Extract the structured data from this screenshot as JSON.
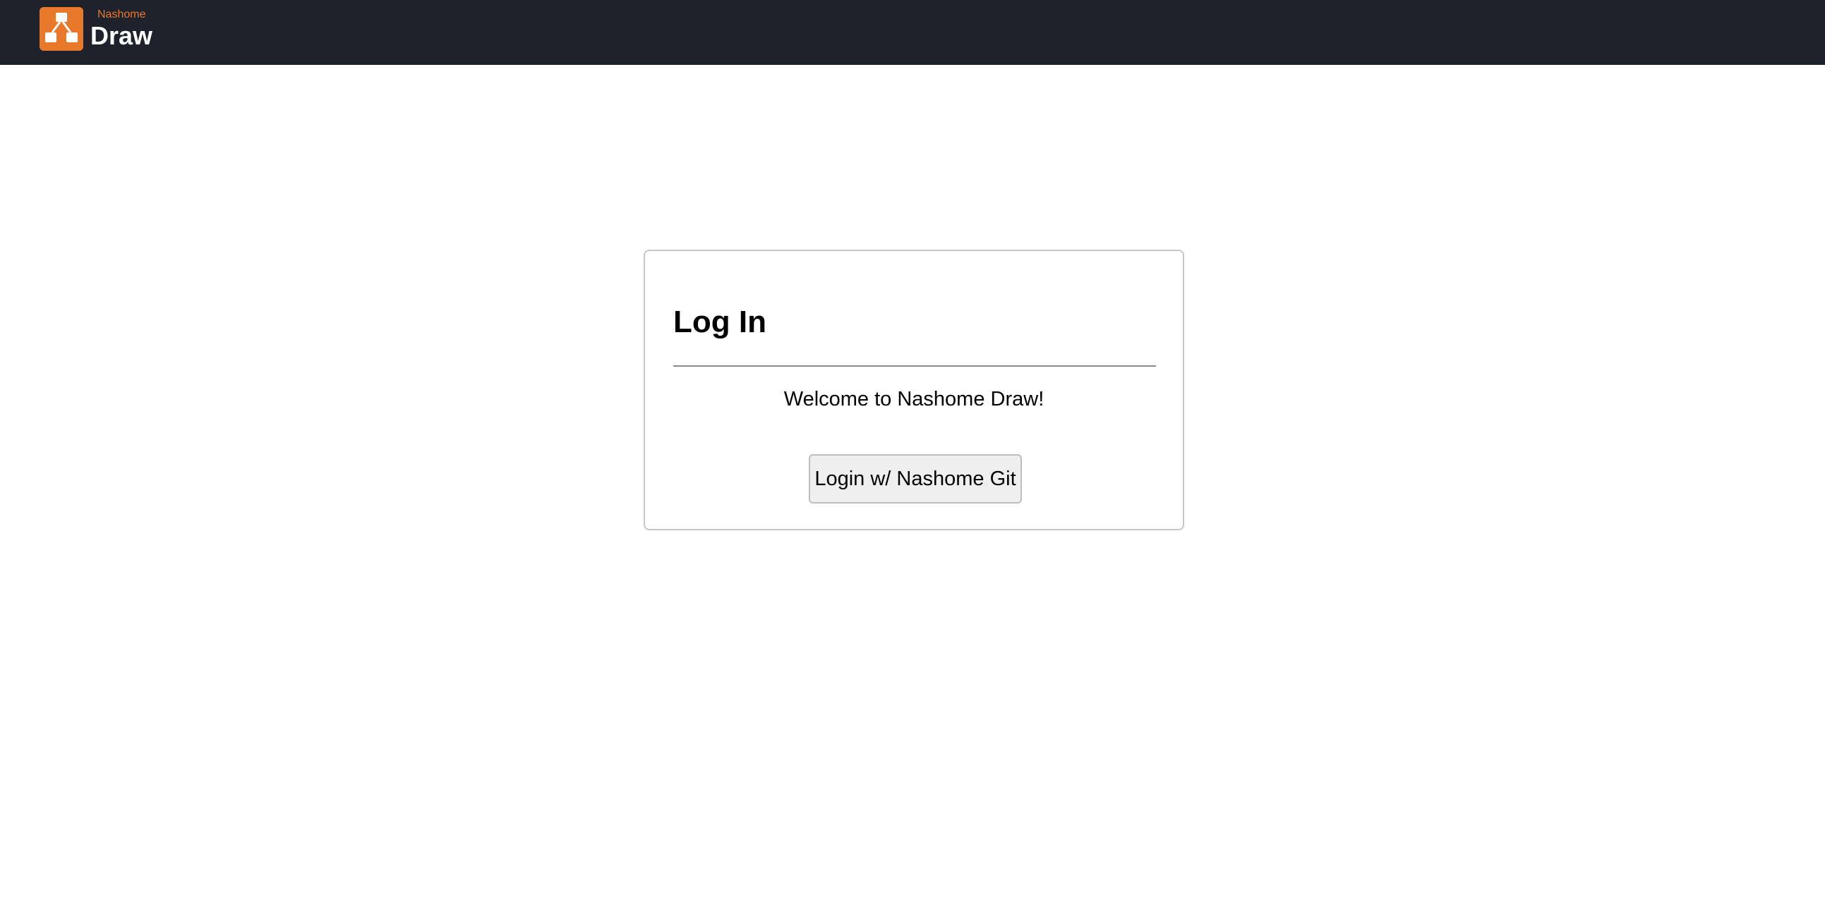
{
  "header": {
    "brand_sub": "Nashome",
    "brand_title": "Draw",
    "logo_icon": "diagram-nodes-icon",
    "colors": {
      "bar_background": "#1f222b",
      "accent": "#e8792a"
    }
  },
  "login_card": {
    "title": "Log In",
    "welcome": "Welcome to Nashome Draw!",
    "button_label": "Login w/ Nashome Git"
  }
}
